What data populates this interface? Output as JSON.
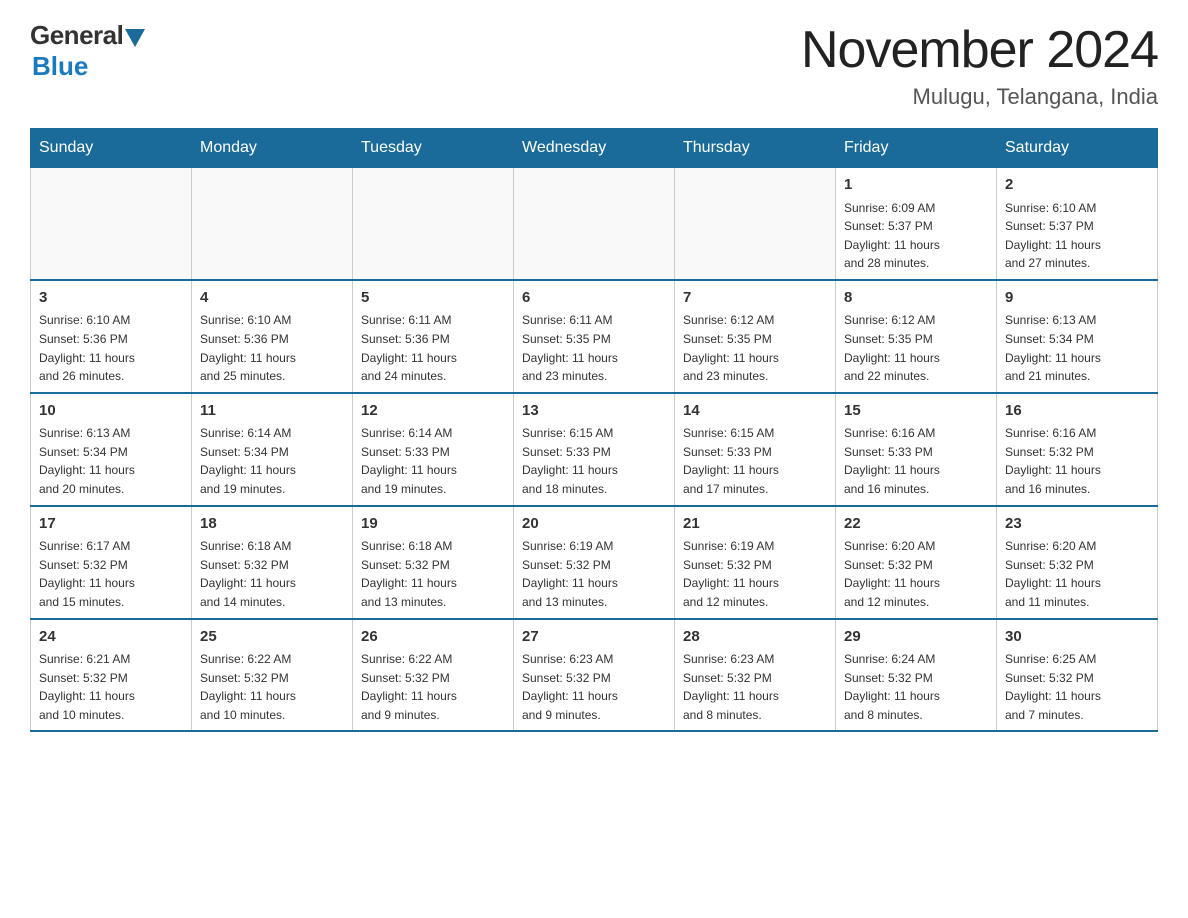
{
  "header": {
    "logo_general": "General",
    "logo_blue": "Blue",
    "month_title": "November 2024",
    "location": "Mulugu, Telangana, India"
  },
  "weekdays": [
    "Sunday",
    "Monday",
    "Tuesday",
    "Wednesday",
    "Thursday",
    "Friday",
    "Saturday"
  ],
  "weeks": [
    [
      {
        "day": "",
        "info": ""
      },
      {
        "day": "",
        "info": ""
      },
      {
        "day": "",
        "info": ""
      },
      {
        "day": "",
        "info": ""
      },
      {
        "day": "",
        "info": ""
      },
      {
        "day": "1",
        "info": "Sunrise: 6:09 AM\nSunset: 5:37 PM\nDaylight: 11 hours\nand 28 minutes."
      },
      {
        "day": "2",
        "info": "Sunrise: 6:10 AM\nSunset: 5:37 PM\nDaylight: 11 hours\nand 27 minutes."
      }
    ],
    [
      {
        "day": "3",
        "info": "Sunrise: 6:10 AM\nSunset: 5:36 PM\nDaylight: 11 hours\nand 26 minutes."
      },
      {
        "day": "4",
        "info": "Sunrise: 6:10 AM\nSunset: 5:36 PM\nDaylight: 11 hours\nand 25 minutes."
      },
      {
        "day": "5",
        "info": "Sunrise: 6:11 AM\nSunset: 5:36 PM\nDaylight: 11 hours\nand 24 minutes."
      },
      {
        "day": "6",
        "info": "Sunrise: 6:11 AM\nSunset: 5:35 PM\nDaylight: 11 hours\nand 23 minutes."
      },
      {
        "day": "7",
        "info": "Sunrise: 6:12 AM\nSunset: 5:35 PM\nDaylight: 11 hours\nand 23 minutes."
      },
      {
        "day": "8",
        "info": "Sunrise: 6:12 AM\nSunset: 5:35 PM\nDaylight: 11 hours\nand 22 minutes."
      },
      {
        "day": "9",
        "info": "Sunrise: 6:13 AM\nSunset: 5:34 PM\nDaylight: 11 hours\nand 21 minutes."
      }
    ],
    [
      {
        "day": "10",
        "info": "Sunrise: 6:13 AM\nSunset: 5:34 PM\nDaylight: 11 hours\nand 20 minutes."
      },
      {
        "day": "11",
        "info": "Sunrise: 6:14 AM\nSunset: 5:34 PM\nDaylight: 11 hours\nand 19 minutes."
      },
      {
        "day": "12",
        "info": "Sunrise: 6:14 AM\nSunset: 5:33 PM\nDaylight: 11 hours\nand 19 minutes."
      },
      {
        "day": "13",
        "info": "Sunrise: 6:15 AM\nSunset: 5:33 PM\nDaylight: 11 hours\nand 18 minutes."
      },
      {
        "day": "14",
        "info": "Sunrise: 6:15 AM\nSunset: 5:33 PM\nDaylight: 11 hours\nand 17 minutes."
      },
      {
        "day": "15",
        "info": "Sunrise: 6:16 AM\nSunset: 5:33 PM\nDaylight: 11 hours\nand 16 minutes."
      },
      {
        "day": "16",
        "info": "Sunrise: 6:16 AM\nSunset: 5:32 PM\nDaylight: 11 hours\nand 16 minutes."
      }
    ],
    [
      {
        "day": "17",
        "info": "Sunrise: 6:17 AM\nSunset: 5:32 PM\nDaylight: 11 hours\nand 15 minutes."
      },
      {
        "day": "18",
        "info": "Sunrise: 6:18 AM\nSunset: 5:32 PM\nDaylight: 11 hours\nand 14 minutes."
      },
      {
        "day": "19",
        "info": "Sunrise: 6:18 AM\nSunset: 5:32 PM\nDaylight: 11 hours\nand 13 minutes."
      },
      {
        "day": "20",
        "info": "Sunrise: 6:19 AM\nSunset: 5:32 PM\nDaylight: 11 hours\nand 13 minutes."
      },
      {
        "day": "21",
        "info": "Sunrise: 6:19 AM\nSunset: 5:32 PM\nDaylight: 11 hours\nand 12 minutes."
      },
      {
        "day": "22",
        "info": "Sunrise: 6:20 AM\nSunset: 5:32 PM\nDaylight: 11 hours\nand 12 minutes."
      },
      {
        "day": "23",
        "info": "Sunrise: 6:20 AM\nSunset: 5:32 PM\nDaylight: 11 hours\nand 11 minutes."
      }
    ],
    [
      {
        "day": "24",
        "info": "Sunrise: 6:21 AM\nSunset: 5:32 PM\nDaylight: 11 hours\nand 10 minutes."
      },
      {
        "day": "25",
        "info": "Sunrise: 6:22 AM\nSunset: 5:32 PM\nDaylight: 11 hours\nand 10 minutes."
      },
      {
        "day": "26",
        "info": "Sunrise: 6:22 AM\nSunset: 5:32 PM\nDaylight: 11 hours\nand 9 minutes."
      },
      {
        "day": "27",
        "info": "Sunrise: 6:23 AM\nSunset: 5:32 PM\nDaylight: 11 hours\nand 9 minutes."
      },
      {
        "day": "28",
        "info": "Sunrise: 6:23 AM\nSunset: 5:32 PM\nDaylight: 11 hours\nand 8 minutes."
      },
      {
        "day": "29",
        "info": "Sunrise: 6:24 AM\nSunset: 5:32 PM\nDaylight: 11 hours\nand 8 minutes."
      },
      {
        "day": "30",
        "info": "Sunrise: 6:25 AM\nSunset: 5:32 PM\nDaylight: 11 hours\nand 7 minutes."
      }
    ]
  ]
}
